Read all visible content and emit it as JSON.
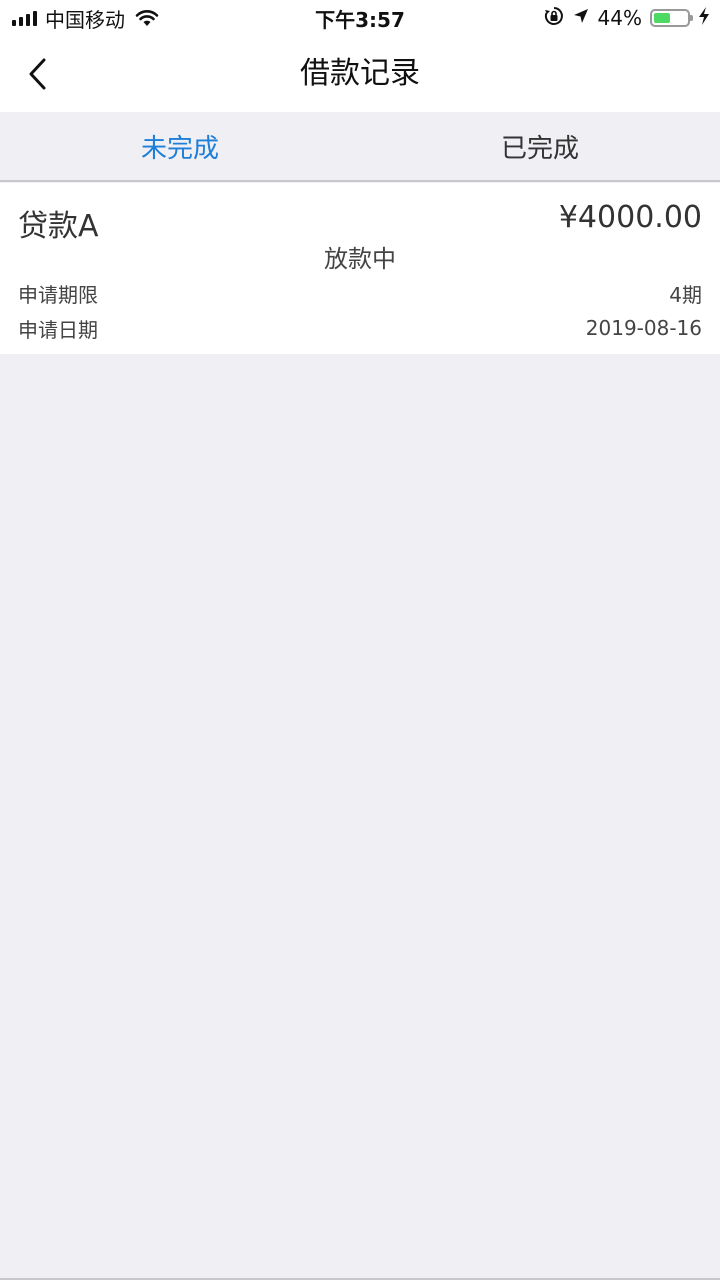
{
  "status_bar": {
    "carrier": "中国移动",
    "time": "下午3:57",
    "battery_percent_label": "44%",
    "battery_level": 0.44,
    "icons": [
      "signal-icon",
      "wifi-icon",
      "orientation-lock-icon",
      "location-icon",
      "battery-icon",
      "charging-icon"
    ]
  },
  "nav": {
    "title": "借款记录",
    "back_icon": "chevron-left-icon"
  },
  "tabs": [
    {
      "label": "未完成",
      "active": true
    },
    {
      "label": "已完成",
      "active": false
    }
  ],
  "records": [
    {
      "name": "贷款A",
      "amount": "¥4000.00",
      "status": "放款中",
      "term_label": "申请期限",
      "term_value": "4期",
      "date_label": "申请日期",
      "date_value": "2019-08-16"
    }
  ],
  "colors": {
    "accent": "#1e7fd8",
    "background": "#efeff4",
    "card": "#ffffff",
    "battery_fill": "#4cd964"
  }
}
